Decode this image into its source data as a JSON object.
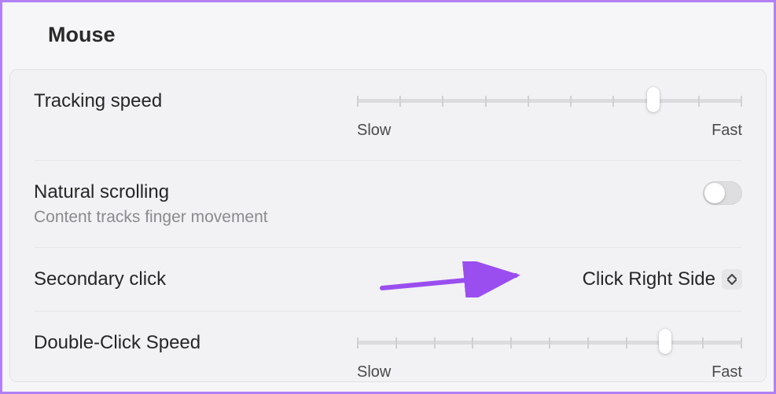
{
  "title": "Mouse",
  "tracking": {
    "label": "Tracking speed",
    "min_label": "Slow",
    "max_label": "Fast",
    "ticks": 10,
    "value_pct": 77
  },
  "natural_scrolling": {
    "label": "Natural scrolling",
    "sublabel": "Content tracks finger movement",
    "on": false
  },
  "secondary_click": {
    "label": "Secondary click",
    "value": "Click Right Side"
  },
  "double_click": {
    "label": "Double-Click Speed",
    "min_label": "Slow",
    "max_label": "Fast",
    "ticks": 11,
    "value_pct": 80
  },
  "annotation": {
    "color": "#9a4ef0"
  }
}
